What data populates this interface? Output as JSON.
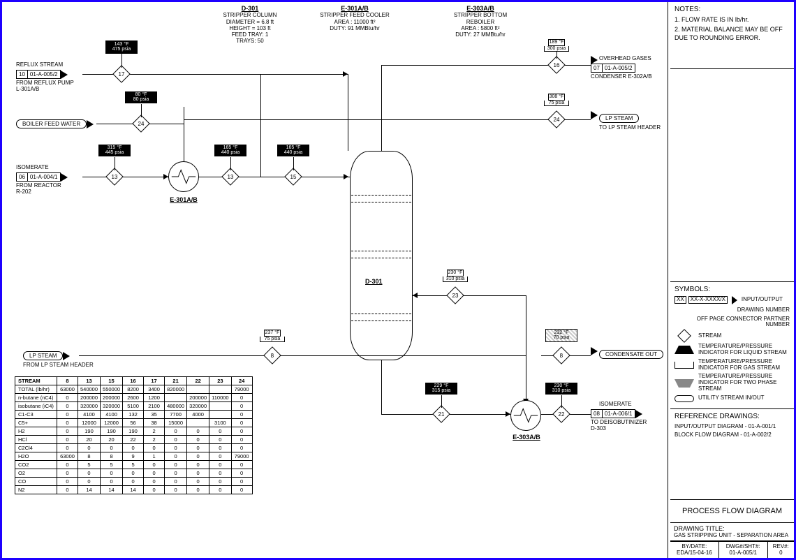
{
  "equipment": {
    "d301": {
      "tag": "D-301",
      "name": "STRIPPER COLUMN",
      "l1": "DIAMETER = 6.8 ft",
      "l2": "HEIGHT = 103 ft",
      "l3": "FEED TRAY: 1",
      "l4": "TRAYS: 50"
    },
    "e301": {
      "tag": "E-301A/B",
      "name": "STRIPPER FEED COOLER",
      "l1": "AREA : 11000 ft²",
      "l2": "DUTY: 91 MMBtu/hr"
    },
    "e303": {
      "tag": "E-303A/B",
      "name": "STRIPPER BOTTOM",
      "l1": "REBOILER",
      "l2": "AREA : 5800 ft²",
      "l3": "DUTY: 27 MMBtu/hr"
    }
  },
  "conn": {
    "reflux": {
      "label": "REFLUX STREAM",
      "num": "10",
      "ref": "01-A-005/2",
      "sub": "FROM REFLUX PUMP\nL-301A/B"
    },
    "bfw": {
      "label": "BOILER FEED WATER"
    },
    "isom_in": {
      "label": "ISOMERATE",
      "num": "06",
      "ref": "01-A-004/1",
      "sub": "FROM REACTOR\nR-202"
    },
    "lpsteam_in": {
      "label": "LP STEAM",
      "sub": "FROM  LP STEAM HEADER"
    },
    "overhead": {
      "label": "OVERHEAD GASES",
      "num": "07",
      "ref": "01-A-005/2",
      "sub": "CONDENSER E-302A/B"
    },
    "lpsteam_out": {
      "label": "LP STEAM",
      "sub": "TO LP STEAM HEADER"
    },
    "cond_out": {
      "label": "CONDENSATE OUT"
    },
    "isom_out": {
      "label": "ISOMERATE",
      "num": "08",
      "ref": "01-A-006/1",
      "sub": "TO DEISOBUTINIZER\nD-303"
    }
  },
  "ind": {
    "17": {
      "t": "143 °F",
      "p": "475 psia"
    },
    "24a": {
      "t": "80 °F",
      "p": "80 psia"
    },
    "13a": {
      "t": "315 °F",
      "p": "445 psia"
    },
    "13b": {
      "t": "165 °F",
      "p": "440 psia"
    },
    "15": {
      "t": "165 °F",
      "p": "440 psia"
    },
    "16": {
      "t": "189 °F",
      "p": "300 psia"
    },
    "24b": {
      "t": "308 °F",
      "p": "75 psia"
    },
    "8a": {
      "t": "237 °F",
      "p": "75 psia"
    },
    "23": {
      "t": "230 °F",
      "p": "310 psia"
    },
    "8b": {
      "t": "232 °F",
      "p": "70 psia"
    },
    "21": {
      "t": "229 °F",
      "p": "315 psia"
    },
    "22": {
      "t": "230 °F",
      "p": "310 psia"
    }
  },
  "nodes": {
    "17": "17",
    "24": "24",
    "13": "13",
    "15": "15",
    "16": "16",
    "8": "8",
    "23": "23",
    "21": "21",
    "22": "22"
  },
  "d301Label": "D-301",
  "e301Tag": "E-301A/B",
  "e303Tag": "E-303A/B",
  "notes": {
    "hdr": "NOTES:",
    "n1": "1.  FLOW RATE IS IN lb/hr.",
    "n2": "2.  MATERIAL BALANCE MAY BE OFF DUE TO ROUNDING ERROR."
  },
  "symbols": {
    "hdr": "SYMBOLS:",
    "xx": "XX",
    "xxref": "XX-X-XXXX/X",
    "io": "INPUT/OUTPUT",
    "dn": "DRAWING NUMBER",
    "op": "OFF PAGE CONNECTOR PARTNER NUMBER",
    "stream": "STREAM",
    "liq": "TEMPERATURE/PRESSURE INDICATOR FOR LIQUID STREAM",
    "gas": "TEMPERATURE/PRESSURE INDICATOR FOR GAS STREAM",
    "tp": "TEMPERATURE/PRESSURE INDICATOR FOR TWO PHASE STREAM",
    "util": "UTILITY STREAM IN/OUT"
  },
  "refs": {
    "hdr": "REFERENCE DRAWINGS:",
    "r1": "INPUT/OUTPUT DIAGRAM - 01-A-001/1",
    "r2": "BLOCK FLOW DIAGRAM - 01-A-002/2"
  },
  "pfd": "PROCESS FLOW DIAGRAM",
  "dtitle": {
    "hdr": "DRAWING TITLE:",
    "val": "GAS STRIPPING  UNIT - SEPARATION  AREA"
  },
  "footer": {
    "by_h": "BY/DATE:",
    "by_v": "EDA/15-04-16",
    "dwg_h": "DWG#/SHT#:",
    "dwg_v": "01-A-005/1",
    "rev_h": "REV#:",
    "rev_v": "0"
  },
  "table": {
    "cols": [
      "STREAM",
      "8",
      "13",
      "15",
      "16",
      "17",
      "21",
      "22",
      "23",
      "24"
    ],
    "rows": [
      {
        "h": "TOTAL (lb/hr)",
        "v": [
          "63000",
          "540000",
          "550000",
          "8200",
          "3400",
          "820000",
          "",
          "",
          "79000"
        ]
      },
      {
        "h": "n-butane (nC4)",
        "v": [
          "0",
          "200000",
          "200000",
          "2600",
          "1200",
          "",
          "200000",
          "110000",
          "0"
        ]
      },
      {
        "h": "isobutane (iC4)",
        "v": [
          "0",
          "320000",
          "320000",
          "5100",
          "2100",
          "480000",
          "320000",
          "",
          "0"
        ]
      },
      {
        "h": "C1-C3",
        "v": [
          "0",
          "4100",
          "4100",
          "132",
          "35",
          "7700",
          "4000",
          "",
          "0"
        ]
      },
      {
        "h": "C5+",
        "v": [
          "0",
          "12000",
          "12000",
          "56",
          "38",
          "15000",
          "",
          "3100",
          "0"
        ]
      },
      {
        "h": "H2",
        "v": [
          "0",
          "190",
          "190",
          "190",
          "2",
          "0",
          "0",
          "0",
          "0"
        ]
      },
      {
        "h": "HCl",
        "v": [
          "0",
          "20",
          "20",
          "22",
          "2",
          "0",
          "0",
          "0",
          "0"
        ]
      },
      {
        "h": "C2Cl4",
        "v": [
          "0",
          "0",
          "0",
          "0",
          "0",
          "0",
          "0",
          "0",
          "0"
        ]
      },
      {
        "h": "H2O",
        "v": [
          "63000",
          "8",
          "8",
          "9",
          "1",
          "0",
          "0",
          "0",
          "79000"
        ]
      },
      {
        "h": "CO2",
        "v": [
          "0",
          "5",
          "5",
          "5",
          "0",
          "0",
          "0",
          "0",
          "0"
        ]
      },
      {
        "h": "O2",
        "v": [
          "0",
          "0",
          "0",
          "0",
          "0",
          "0",
          "0",
          "0",
          "0"
        ]
      },
      {
        "h": "CO",
        "v": [
          "0",
          "0",
          "0",
          "0",
          "0",
          "0",
          "0",
          "0",
          "0"
        ]
      },
      {
        "h": "N2",
        "v": [
          "0",
          "14",
          "14",
          "14",
          "0",
          "0",
          "0",
          "0",
          "0"
        ]
      }
    ]
  }
}
